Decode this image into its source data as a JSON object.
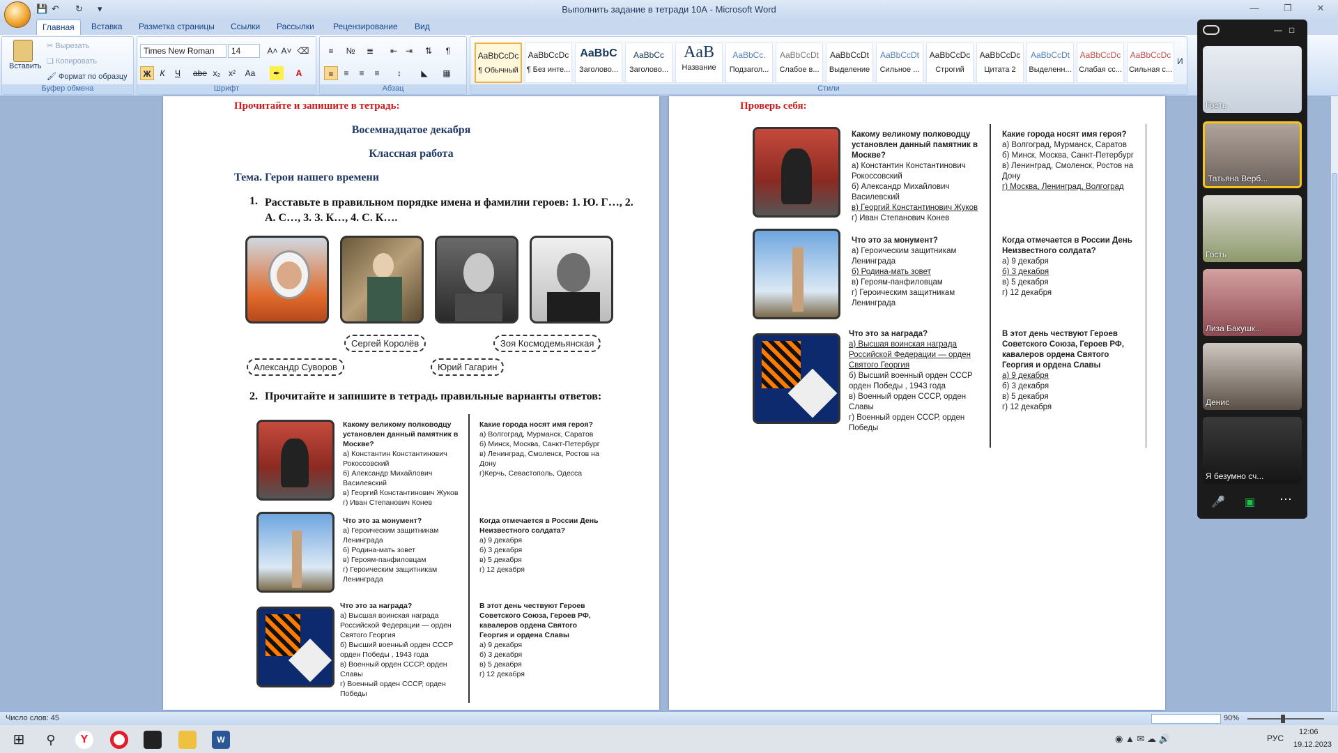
{
  "window": {
    "title": "Выполнить задание в тетради 10А - Microsoft Word"
  },
  "tabs": [
    "Главная",
    "Вставка",
    "Разметка страницы",
    "Ссылки",
    "Рассылки",
    "Рецензирование",
    "Вид"
  ],
  "clipboard": {
    "paste": "Вставить",
    "cut": "Вырезать",
    "copy": "Копировать",
    "format": "Формат по образцу",
    "label": "Буфер обмена"
  },
  "font": {
    "name": "Times New Roman",
    "size": "14",
    "label": "Шрифт"
  },
  "paragraph": {
    "label": "Абзац"
  },
  "styles": {
    "label": "Стили",
    "items": [
      {
        "preview": "AaBbCcDc",
        "name": "¶ Обычный"
      },
      {
        "preview": "AaBbCcDc",
        "name": "¶ Без инте..."
      },
      {
        "preview": "AaBbC",
        "name": "Заголово..."
      },
      {
        "preview": "AaBbCc",
        "name": "Заголово..."
      },
      {
        "preview": "AaB",
        "name": "Название"
      },
      {
        "preview": "AaBbCc.",
        "name": "Подзагол..."
      },
      {
        "preview": "AaBbCcDt",
        "name": "Слабое в..."
      },
      {
        "preview": "AaBbCcDt",
        "name": "Выделение"
      },
      {
        "preview": "AaBbCcDt",
        "name": "Сильное ..."
      },
      {
        "preview": "AaBbCcDc",
        "name": "Строгий"
      },
      {
        "preview": "AaBbCcDc",
        "name": "Цитата 2"
      },
      {
        "preview": "AaBbCcDt",
        "name": "Выделенн..."
      },
      {
        "preview": "AaBbCcDc",
        "name": "Слабая сс..."
      },
      {
        "preview": "AaBbCcDc",
        "name": "Сильная с..."
      }
    ],
    "more": "И"
  },
  "page1": {
    "instruction": "Прочитайте и запишите в тетрадь:",
    "date": "Восемнадцатое декабря",
    "work": "Классная работа",
    "topic": "Тема. Герои нашего времени",
    "task1_num": "1.",
    "task1": "Расставьте в правильном порядке имена и фамилии героев: 1. Ю. Г…, 2. А. С…, 3. З. К…, 4. С. К….",
    "names": [
      "Сергей Королёв",
      "Зоя Космодемьянская",
      "Александр Суворов",
      "Юрий Гагарин"
    ],
    "task2_num": "2.",
    "task2": "Прочитайте и запишите в тетрадь правильные варианты ответов:",
    "q1": {
      "title": "Какому великому полководцу установлен данный памятник в Москве?",
      "opts": [
        "а) Константин Константинович Рокоссовский",
        "б) Александр Михайлович Василевский",
        "в) Георгий Константинович Жуков",
        "г) Иван Степанович Конев"
      ]
    },
    "q2": {
      "title": "Какие города носят имя героя?",
      "opts": [
        "а) Волгоград, Мурманск, Саратов",
        "б) Минск, Москва, Санкт-Петербург",
        "в) Ленинград, Смоленск, Ростов на Дону",
        "г)Керчь, Севастополь, Одесса"
      ]
    },
    "q3": {
      "title": "Что это за монумент?",
      "opts": [
        "а) Героическим защитникам Ленинграда",
        "б) Родина-мать зовет",
        "в) Героям-панфиловцам",
        "г) Героическим защитникам Ленинграда"
      ]
    },
    "q4": {
      "title": "Когда отмечается в России День Неизвестного солдата?",
      "opts": [
        "а) 9 декабря",
        "б) 3 декабря",
        "в) 5 декабря",
        "г) 12 декабря"
      ]
    },
    "q5": {
      "title": "Что это за награда?",
      "opts": [
        "а) Высшая воинская награда Российской Федерации — орден Святого Георгия",
        "б) Высший военный орден СССР орден Победы , 1943 года",
        "в) Военный орден СССР, орден Славы",
        "г) Военный орден СССР, орден Победы"
      ]
    },
    "q6": {
      "title": "В этот день чествуют Героев Советского Союза, Героев РФ, кавалеров ордена Святого Георгия и ордена Славы",
      "opts": [
        "а) 9 декабря",
        "б) 3 декабря",
        "в) 5 декабря",
        "г) 12 декабря"
      ]
    }
  },
  "page2": {
    "heading": "Проверь себя:",
    "q1": {
      "title": "Какому великому полководцу установлен данный памятник в Москве?",
      "opts": [
        "а) Константин Константинович Рокоссовский",
        "б) Александр Михайлович Василевский",
        "в) Георгий Константинович Жуков",
        "г) Иван Степанович Конев"
      ]
    },
    "q2": {
      "title": "Какие города носят имя героя?",
      "opts": [
        "а) Волгоград, Мурманск, Саратов",
        "б) Минск, Москва, Санкт-Петербург",
        "в) Ленинград, Смоленск, Ростов на Дону",
        "г) Москва, Ленинград, Волгоград"
      ]
    },
    "q3": {
      "title": "Что это за монумент?",
      "opts": [
        "а) Героическим защитникам Ленинграда",
        "б) Родина-мать зовет",
        "в) Героям-панфиловцам",
        "г) Героическим защитникам Ленинграда"
      ]
    },
    "q4": {
      "title": "Когда отмечается в России День Неизвестного солдата?",
      "opts": [
        "а) 9 декабря",
        "б) 3 декабря",
        "в) 5 декабря",
        "г) 12 декабря"
      ]
    },
    "q5": {
      "title": "Что это за награда?",
      "opts": [
        "а) Высшая воинская награда Российской Федерации — орден Святого Георгия",
        "б) Высший военный орден СССР орден Победы , 1943 года",
        "в) Военный орден СССР, орден Славы",
        "г) Военный орден СССР, орден Победы"
      ]
    },
    "q6": {
      "title": "В этот день чествуют Героев Советского Союза, Героев РФ, кавалеров ордена Святого Георгия и ордена Славы",
      "opts": [
        "а) 9 декабря",
        "б) 3 декабря",
        "в) 5 декабря",
        "г) 12 декабря"
      ]
    }
  },
  "statusbar": {
    "words": "Число слов: 45",
    "zoom": "90%"
  },
  "video": {
    "participants": [
      "Гость",
      "Татьяна Верб...",
      "Гость",
      "Лиза Бакушк...",
      "Денис",
      "Я безумно сч..."
    ]
  },
  "tray": {
    "lang": "РУС",
    "time": "12:06",
    "date": "19.12.2023"
  }
}
